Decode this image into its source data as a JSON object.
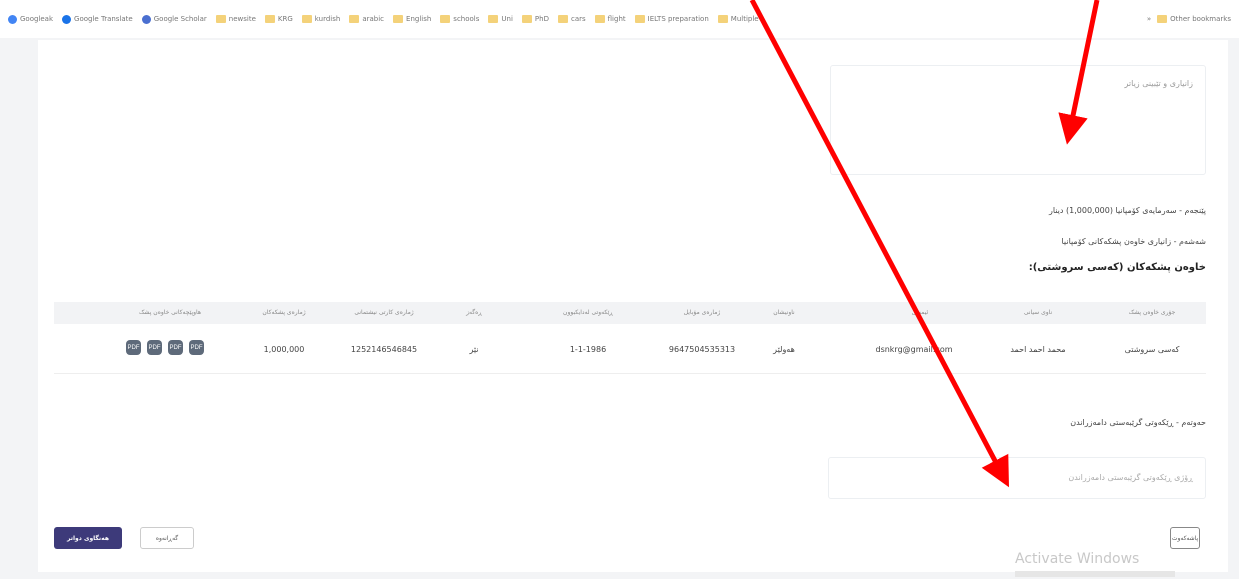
{
  "bookmarks": {
    "items": [
      "Googleak",
      "Google Translate",
      "Google Scholar",
      "newsite",
      "KRG",
      "kurdish",
      "arabic",
      "English",
      "schools",
      "Uni",
      "PhD",
      "cars",
      "flight",
      "IELTS preparation",
      "Multiple"
    ],
    "other": "Other bookmarks"
  },
  "form": {
    "top_box_label": "زانیاری و تێبینی زیاتر",
    "line5": "پێنجەم - سەرمایەی کۆمپانیا (1,000,000) دینار",
    "line6": "شەشەم - زانیاری خاوەن پشکەکانی کۆمپانیا",
    "heading": "خاوەن پشکەکان (کەسی سروشتی):",
    "line7": "حەوتەم - ڕێکەوتی گرێبەستی دامەزراندن",
    "bottom_box_placeholder": "ڕۆژی ڕێکەوتی گرێبەستی دامەزراندن"
  },
  "table": {
    "headers": [
      "جۆری خاوەن پشک",
      "ناوی سیانی",
      "ئیمەیڵ",
      "ناونیشان",
      "ژمارەی مۆبایل",
      "ڕێکەوتی لەدایکبوون",
      "ڕەگەز",
      "ژمارەی کارتی نیشتمانی",
      "ژمارەی پشکەکان",
      "هاوپێچەکانی خاوەن پشک"
    ],
    "row": [
      "کەسی سروشتی",
      "محمد احمد احمد",
      "dsnkrg@gmail.com",
      "هەولێر",
      "9647504535313",
      "1-1-1986",
      "نێر",
      "1252146546845",
      "1,000,000"
    ],
    "actions": [
      "PDF",
      "PDF",
      "PDF",
      "PDF"
    ]
  },
  "buttons": {
    "submit": "هەنگاوی دواتر",
    "cancel": "گەڕانەوە",
    "back": "پاشەکەوت"
  },
  "watermark": "Activate Windows",
  "colors": {
    "primary": "#3d3a7a",
    "annotation_arrow": "#ff0000"
  }
}
